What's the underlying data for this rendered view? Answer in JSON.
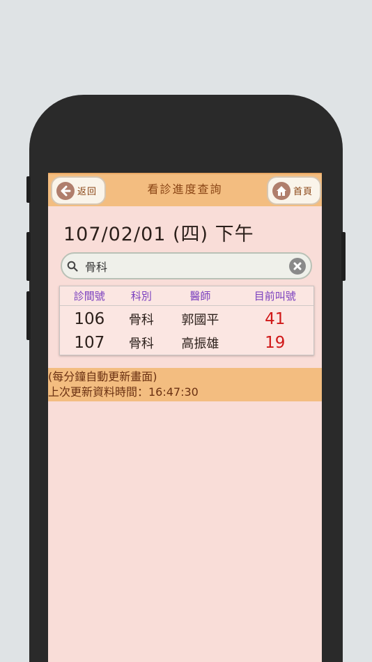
{
  "header": {
    "back_label": "返回",
    "title": "看診進度查詢",
    "home_label": "首頁"
  },
  "session": {
    "date_text": "107/02/01 (四) 下午"
  },
  "search": {
    "value": "骨科"
  },
  "table": {
    "headers": [
      "診間號",
      "科別",
      "醫師",
      "目前叫號"
    ],
    "rows": [
      {
        "room": "106",
        "dept": "骨科",
        "doctor": "郭國平",
        "current": "41"
      },
      {
        "room": "107",
        "dept": "骨科",
        "doctor": "高振雄",
        "current": "19"
      }
    ]
  },
  "info": {
    "auto_refresh": "(每分鐘自動更新畫面)",
    "last_update": "上次更新資料時間：16:47:30"
  },
  "colors": {
    "header_bg": "#f3bd80",
    "screen_bg": "#f9ddd8",
    "header_text": "#8a4515",
    "column_header_text": "#7a3fbf",
    "call_number_text": "#d01818"
  },
  "icons": {
    "back": "arrow-left-icon",
    "home": "home-icon",
    "search": "search-icon",
    "clear": "close-icon"
  }
}
